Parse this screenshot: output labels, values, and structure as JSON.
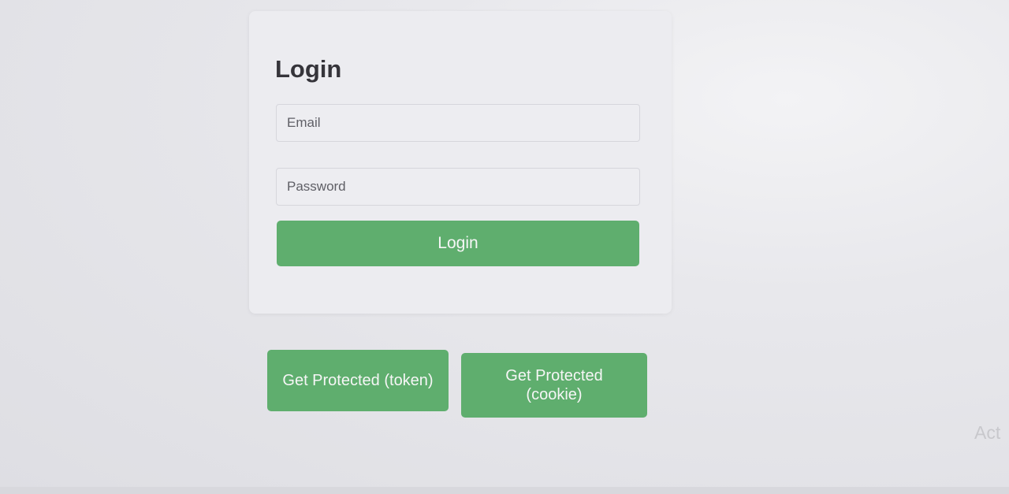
{
  "login_card": {
    "title": "Login",
    "email_placeholder": "Email",
    "password_placeholder": "Password",
    "login_button_label": "Login"
  },
  "actions": {
    "token_button_label": "Get Protected (token)",
    "cookie_button_label": "Get Protected\n(cookie)"
  },
  "watermark": {
    "text": "Act"
  },
  "colors": {
    "accent_green": "#5fae6e",
    "card_background": "#ececf0",
    "page_background": "#e6e6ea",
    "title_text": "#35343a"
  }
}
